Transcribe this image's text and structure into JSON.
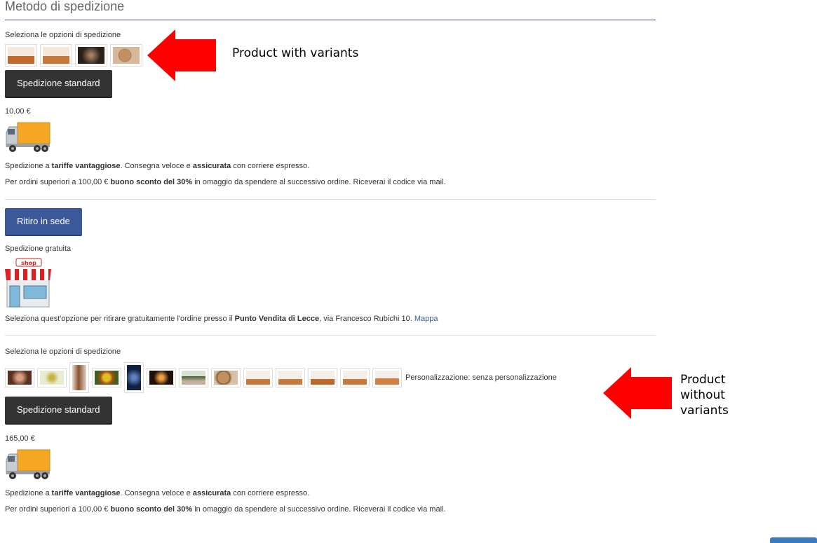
{
  "section": {
    "title": "Metodo di spedizione"
  },
  "standard1": {
    "options_label": "Seleziona le opzioni di spedizione",
    "button_label": "Spedizione standard",
    "price": "10,00 €",
    "desc_pre": "Spedizione a ",
    "desc_bold1": "tariffe vantaggiose",
    "desc_mid": ". Consegna veloce e ",
    "desc_bold2": "assicurata",
    "desc_post": " con corriere espresso.",
    "promo_pre": "Per ordini superiori a 100,00 € ",
    "promo_bold": "buono sconto del 30%",
    "promo_post": " in omaggio da spendere al successivo ordine. Riceverai il codice via mail."
  },
  "pickup": {
    "button_label": "Ritiro in sede",
    "subtitle": "Spedizione gratuita",
    "shop_sign": "shop",
    "desc_pre": "Seleziona quest'opzione per ritirare gratuitamente l'ordine presso il ",
    "desc_bold": "Punto Vendita di Lecce",
    "desc_post": ", via Francesco Rubichi 10. ",
    "map_link": "Mappa"
  },
  "standard2": {
    "options_label": "Seleziona le opzioni di spedizione",
    "personalization": "Personalizzazione: senza personalizzazione",
    "button_label": "Spedizione standard",
    "price": "165,00 €",
    "desc_pre": "Spedizione a ",
    "desc_bold1": "tariffe vantaggiose",
    "desc_mid": ". Consegna veloce e ",
    "desc_bold2": "assicurata",
    "desc_post": " con corriere espresso.",
    "promo_pre": "Per ordini superiori a 100,00 € ",
    "promo_bold": "buono sconto del 30%",
    "promo_post": " in omaggio da spendere al successivo ordine. Riceverai il codice via mail."
  },
  "annotations": {
    "with_variants": "Product with variants",
    "without_line1": "Product",
    "without_line2": "without",
    "without_line3": "variants",
    "arrow_color": "#ff0000"
  },
  "colors": {
    "button_dark": "#333333",
    "button_blue": "#3b5998",
    "link": "#3b5998",
    "truck_cargo": "#f5a623"
  }
}
